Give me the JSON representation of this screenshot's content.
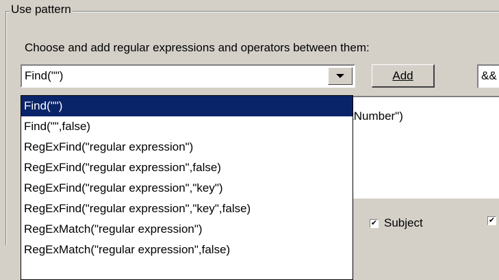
{
  "group": {
    "title": "Use pattern"
  },
  "hint": "Choose and add regular expressions and operators between them:",
  "combo": {
    "value": "Find(\"\")"
  },
  "add_button": {
    "label": "Add"
  },
  "operator": {
    "value": "&&"
  },
  "expression": {
    "visible_text": "tNumber\")"
  },
  "checkboxes": [
    {
      "label": "Subject",
      "checked": true
    },
    {
      "label": "",
      "checked": true
    }
  ],
  "dropdown": {
    "selected_index": 0,
    "items": [
      "Find(\"\")",
      "Find(\"\",false)",
      "RegExFind(\"regular expression\")",
      "RegExFind(\"regular expression\",false)",
      "RegExFind(\"regular expression\",\"key\")",
      "RegExFind(\"regular expression\",\"key\",false)",
      "RegExMatch(\"regular expression\")",
      "RegExMatch(\"regular expression\",false)"
    ]
  }
}
